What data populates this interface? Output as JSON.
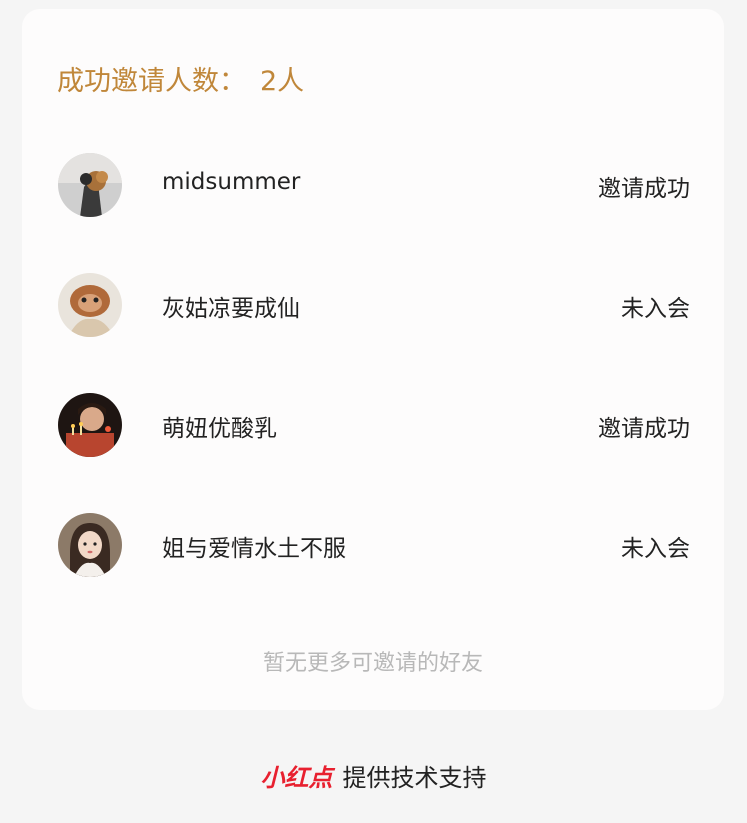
{
  "summary": {
    "label": "成功邀请人数：",
    "count": "2人"
  },
  "friends": [
    {
      "name": "midsummer",
      "status": "邀请成功"
    },
    {
      "name": "灰姑凉要成仙",
      "status": "未入会"
    },
    {
      "name": "萌妞优酸乳",
      "status": "邀请成功"
    },
    {
      "name": "姐与爱情水土不服",
      "status": "未入会"
    }
  ],
  "empty_note": "暂无更多可邀请的好友",
  "footer": {
    "brand": "小红点",
    "text": "提供技术支持"
  },
  "colors": {
    "accent": "#c0873a",
    "brand": "#e8202f"
  }
}
